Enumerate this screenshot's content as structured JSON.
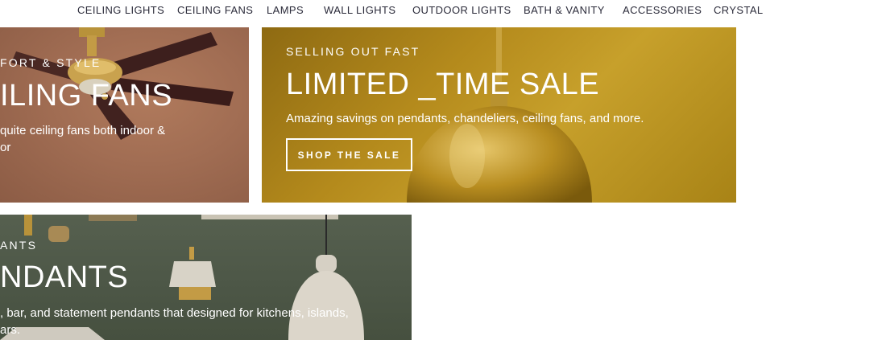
{
  "nav": {
    "items": [
      {
        "label": "CEILING LIGHTS"
      },
      {
        "label": "CEILING FANS"
      },
      {
        "label": "LAMPS"
      },
      {
        "label": "WALL LIGHTS"
      },
      {
        "label": "OUTDOOR LIGHTS"
      },
      {
        "label": "BATH & VANITY"
      },
      {
        "label": "ACCESSORIES"
      },
      {
        "label": "CRYSTAL"
      }
    ]
  },
  "tiles": {
    "fans": {
      "eyebrow": "FORT & STYLE",
      "headline": "ILING FANS",
      "description_lines": [
        "quite ceiling fans both indoor &",
        "or"
      ]
    },
    "sale": {
      "eyebrow": "SELLING OUT FAST",
      "headline": "LIMITED _TIME SALE",
      "description": "Amazing savings on pendants, chandeliers, ceiling fans, and more.",
      "button_label": "SHOP THE SALE"
    },
    "pendants": {
      "eyebrow": "ANTS",
      "headline": "NDANTS",
      "description_lines": [
        ", bar, and statement pendants that designed for kitchens, islands,",
        "ars."
      ]
    }
  },
  "colors": {
    "nav_text": "#2b2b3a",
    "sale_gold": "#b48a1c",
    "fans_terracotta": "#a16d53",
    "pendants_green": "#4d5747"
  }
}
